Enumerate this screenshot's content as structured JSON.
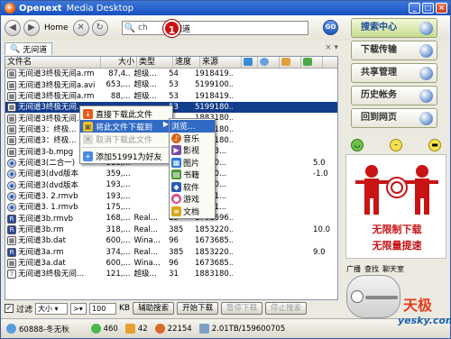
{
  "window": {
    "brand": "Openext",
    "app_name": "Media Desktop",
    "controls": [
      "_",
      "□",
      "×"
    ]
  },
  "toolbar": {
    "back_icon": "back-arrow-icon",
    "home_label": "Home",
    "search_label": "ch",
    "search_value": "无间道",
    "go_label": "GO",
    "marker_label": "1"
  },
  "tab": {
    "label": "无间道",
    "controls": "× ▾"
  },
  "grid": {
    "headers": [
      "文件名",
      "大小",
      "类型",
      "速度",
      "来源",
      "",
      "",
      "",
      ""
    ],
    "rows": [
      {
        "icon": "video",
        "name": "无间道3终极无间a.rm",
        "size": "87,4..",
        "type": "超级...",
        "speed": "54",
        "src": "1918419..",
        "extra": ""
      },
      {
        "icon": "video",
        "name": "无间道3终极无间a.avi",
        "size": "653,...",
        "type": "超级...",
        "speed": "53",
        "src": "5199100..",
        "extra": ""
      },
      {
        "icon": "video",
        "name": "无间道3终极无间a.rm",
        "size": "88,...",
        "type": "超级...",
        "speed": "53",
        "src": "1918419..",
        "extra": ""
      },
      {
        "icon": "video",
        "name": "无间道3终极无间...",
        "size": "",
        "type": "",
        "speed": "53",
        "src": "5199180..",
        "extra": "",
        "selected": true
      },
      {
        "icon": "video",
        "name": "无间道3终极无间...",
        "size": "",
        "type": "",
        "speed": "",
        "src": "1883180..",
        "extra": ""
      },
      {
        "icon": "video",
        "name": "无间道3：终极...",
        "size": "",
        "type": "",
        "speed": "",
        "src": "1883180..",
        "extra": ""
      },
      {
        "icon": "video",
        "name": "无间道3：终极...",
        "size": "",
        "type": "",
        "speed": "",
        "src": "1883180..",
        "extra": ""
      },
      {
        "icon": "video",
        "name": "无间道3-b.mpg",
        "size": "353,...",
        "type": "",
        "speed": "",
        "src": "07823...",
        "extra": ""
      },
      {
        "icon": "audio",
        "name": "无间道3(二合一)",
        "size": "318,...",
        "type": "",
        "speed": "",
        "src": "21690...",
        "extra": "5.0"
      },
      {
        "icon": "audio",
        "name": "无间道3(dvd版本",
        "size": "359,...",
        "type": "",
        "speed": "",
        "src": "81000...",
        "extra": "-1.0"
      },
      {
        "icon": "audio",
        "name": "无间道3(dvd版本",
        "size": "193,...",
        "type": "",
        "speed": "",
        "src": "17800...",
        "extra": ""
      },
      {
        "icon": "audio",
        "name": "无间道3. 2.rmvb",
        "size": "193,...",
        "type": "",
        "speed": "",
        "src": "11611...",
        "extra": ""
      },
      {
        "icon": "audio",
        "name": "无间道3. 1.rmvb",
        "size": "175,...",
        "type": "",
        "speed": "",
        "src": "11611...",
        "extra": ""
      },
      {
        "icon": "app",
        "name": "无间道3b.rmvb",
        "size": "168,...",
        "type": "Real...",
        "speed": "29",
        "src": "1761696..",
        "extra": ""
      },
      {
        "icon": "app",
        "name": "无间道3b.rm",
        "size": "318,...",
        "type": "Real...",
        "speed": "385",
        "src": "1853220..",
        "extra": "10.0"
      },
      {
        "icon": "video",
        "name": "无间道3b.dat",
        "size": "600,...",
        "type": "Wina...",
        "speed": "96",
        "src": "1673685..",
        "extra": ""
      },
      {
        "icon": "app",
        "name": "无间道3a.rm",
        "size": "374,...",
        "type": "Real...",
        "speed": "385",
        "src": "1853220..",
        "extra": "9.0"
      },
      {
        "icon": "video",
        "name": "无间道3a.dat",
        "size": "600,...",
        "type": "Wina...",
        "speed": "96",
        "src": "1673685..",
        "extra": ""
      },
      {
        "icon": "unk",
        "name": "无间道3终极无间...",
        "size": "121,...",
        "type": "超级...",
        "speed": "31",
        "src": "1883180..",
        "extra": ""
      }
    ]
  },
  "context_menu": {
    "items": [
      {
        "label": "直接下载此文件",
        "icon": "download-icon",
        "state": "normal"
      },
      {
        "label": "将此文件下载到",
        "icon": "folder-icon",
        "state": "highlighted",
        "submenu": true
      },
      {
        "label": "取消下载此文件",
        "icon": "cancel-icon",
        "state": "disabled"
      },
      {
        "label": "添加51991为好友",
        "icon": "add-friend-icon",
        "state": "normal"
      }
    ]
  },
  "submenu": {
    "items": [
      {
        "label": "浏览...",
        "highlighted": true
      },
      {
        "label": "音乐",
        "color": "#d8641a"
      },
      {
        "label": "影视",
        "color": "#7a4aa8"
      },
      {
        "label": "图片",
        "color": "#2a7ad8"
      },
      {
        "label": "书籍",
        "color": "#4a9a3a"
      },
      {
        "label": "软件",
        "color": "#2a5ab8"
      },
      {
        "label": "游戏",
        "color": "#d84a8a"
      },
      {
        "label": "文档",
        "color": "#d8a81a"
      }
    ]
  },
  "bottom": {
    "filter_label": "过滤",
    "size_option": "大小",
    "operator": ">",
    "size_value": "100",
    "unit": "KB",
    "buttons": [
      {
        "label": "辅助搜索",
        "enabled": true
      },
      {
        "label": "开始下载",
        "enabled": true
      },
      {
        "label": "暂停下载",
        "enabled": false
      },
      {
        "label": "停止搜索",
        "enabled": false
      }
    ]
  },
  "status": {
    "user": "60888-冬无秋",
    "online": "460",
    "files": "42",
    "peers": "22154",
    "volume": "2.01TB/159600705"
  },
  "sidebar": {
    "items": [
      {
        "label": "搜索中心",
        "active": true
      },
      {
        "label": "下载传输",
        "active": false
      },
      {
        "label": "共享管理",
        "active": false
      },
      {
        "label": "历史帐务",
        "active": false
      },
      {
        "label": "回到网页",
        "active": false
      }
    ]
  },
  "ad": {
    "line1": "无限制下载",
    "line2": "无限量提速"
  },
  "social": [
    "广播",
    "查找",
    "聊天室"
  ],
  "watermark": {
    "brand": "天极",
    "site": "yesky.com"
  }
}
